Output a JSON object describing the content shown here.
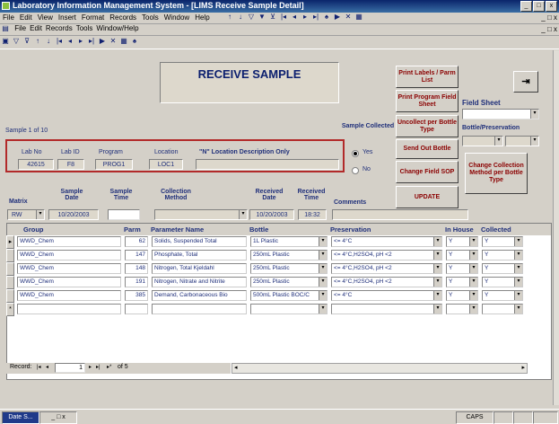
{
  "window": {
    "title": "Laboratory Information Management System - [LIMS Receive Sample Detail]",
    "controls": [
      "_",
      "□",
      "x"
    ]
  },
  "menubar": {
    "items": [
      "File",
      "Edit",
      "View",
      "Insert",
      "Format",
      "Records",
      "Tools",
      "Window",
      "Help"
    ]
  },
  "menubar2": {
    "items": [
      "File",
      "Edit",
      "Records",
      "Tools",
      "Window/Help"
    ]
  },
  "form": {
    "title": "RECEIVE SAMPLE",
    "sample_counter": "Sample 1 of 10",
    "buttons": {
      "print_labels": "Print Labels / Parm List",
      "print_program": "Print Program Field Sheet",
      "uncollect": "Uncollect per Bottle Type",
      "send_out": "Send Out Bottle",
      "change_field_sop": "Change Field SOP",
      "update": "UPDATE",
      "change_collection": "Change Collection Method per Bottle Type"
    },
    "field_sheet_label": "Field Sheet",
    "bottle_preservation_label": "Bottle/Preservation",
    "sample_collected": {
      "label": "Sample Collected",
      "yes": "Yes",
      "no": "No",
      "selected": "Yes"
    },
    "sample_info": {
      "headers": {
        "lab_no": "Lab No",
        "lab_id": "Lab ID",
        "program": "Program",
        "location": "Location",
        "location_desc": "\"N\" Location Description Only"
      },
      "values": {
        "lab_no": "42615",
        "lab_id": "F8",
        "program": "PROG1",
        "location": "LOC1",
        "location_desc": ""
      }
    },
    "receipt": {
      "headers": {
        "matrix": "Matrix",
        "sample_date": "Sample Date",
        "sample_time": "Sample Time",
        "collection_method": "Collection Method",
        "received_date": "Received Date",
        "received_time": "Received Time",
        "comments": "Comments"
      },
      "values": {
        "matrix": "RW",
        "sample_date": "10/20/2003",
        "sample_time": "",
        "collection_method": "",
        "received_date": "10/20/2003",
        "received_time": "18:32",
        "comments": ""
      }
    }
  },
  "grid": {
    "columns": [
      "Group",
      "Parm",
      "Parameter Name",
      "Bottle",
      "Preservation",
      "In House",
      "Collected"
    ],
    "rows": [
      {
        "group": "WWD_Chem",
        "parm": "62",
        "name": "Solids, Suspended Total",
        "bottle": "1L Plastic",
        "preservation": "<= 4°C",
        "in_house": "Y",
        "collected": "Y"
      },
      {
        "group": "WWD_Chem",
        "parm": "147",
        "name": "Phosphate, Total",
        "bottle": "250mL Plastic",
        "preservation": "<= 4°C,H2SO4, pH <2",
        "in_house": "Y",
        "collected": "Y"
      },
      {
        "group": "WWD_Chem",
        "parm": "148",
        "name": "Nitrogen, Total Kjeldahl",
        "bottle": "250mL Plastic",
        "preservation": "<= 4°C,H2SO4, pH <2",
        "in_house": "Y",
        "collected": "Y"
      },
      {
        "group": "WWD_Chem",
        "parm": "191",
        "name": "Nitrogen, Nitrate and Nitrite",
        "bottle": "250mL Plastic",
        "preservation": "<= 4°C,H2SO4, pH <2",
        "in_house": "Y",
        "collected": "Y"
      },
      {
        "group": "WWD_Chem",
        "parm": "385",
        "name": "Demand, Carbonaceous Bio",
        "bottle": "500mL Plastic BOC/C",
        "preservation": "<= 4°C",
        "in_house": "Y",
        "collected": "Y"
      }
    ],
    "new_row_marker": "*",
    "current_row_marker": "▸"
  },
  "record_nav": {
    "label": "Record:",
    "current": "1",
    "of_text": "of 5"
  },
  "status": {
    "caps": "CAPS",
    "task_item": "Date S..."
  }
}
